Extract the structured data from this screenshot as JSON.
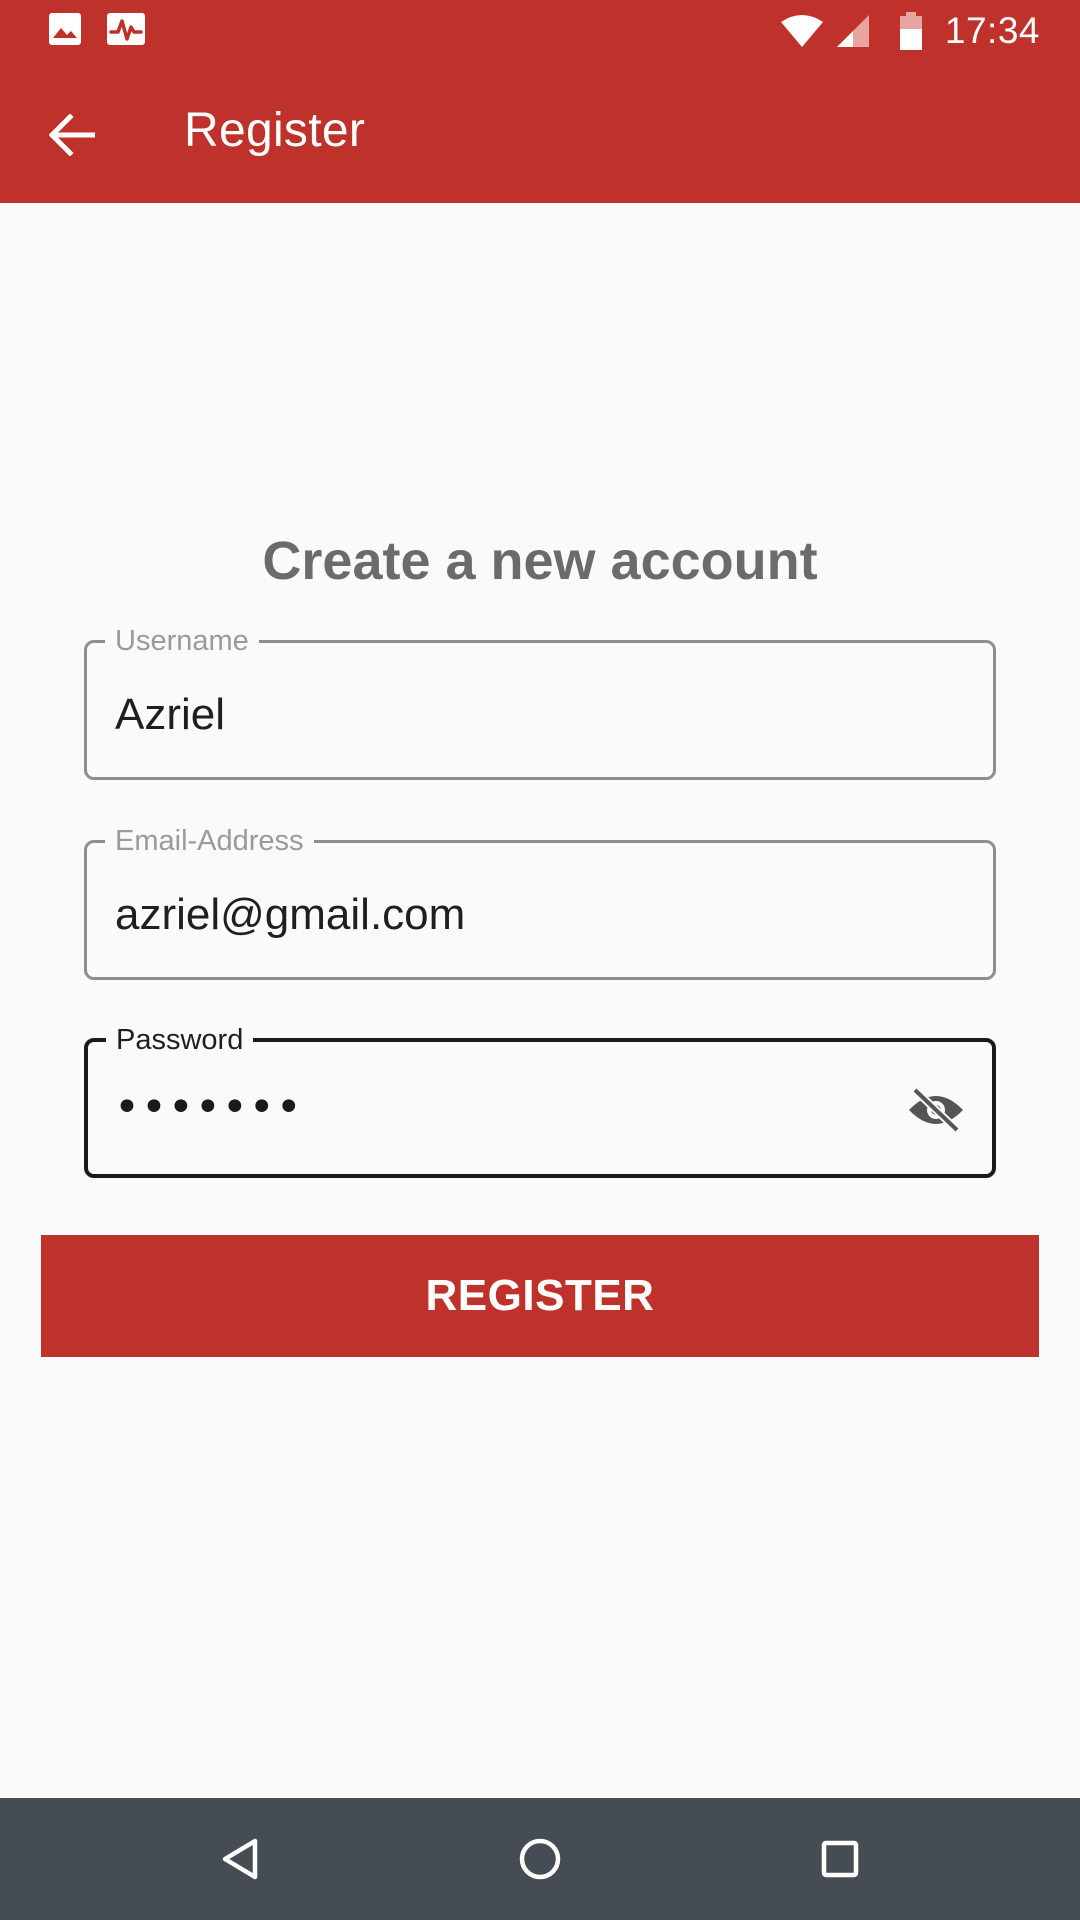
{
  "status_bar": {
    "time": "17:34",
    "left_icons": [
      "image-icon",
      "activity-icon"
    ],
    "right_icons": [
      "wifi-icon",
      "cell-signal-icon",
      "battery-icon"
    ]
  },
  "app_bar": {
    "title": "Register",
    "back_icon": "arrow-back-icon"
  },
  "form": {
    "heading": "Create a new account",
    "username": {
      "label": "Username",
      "value": "Azriel"
    },
    "email": {
      "label": "Email-Address",
      "value": "azriel@gmail.com"
    },
    "password": {
      "label": "Password",
      "value_masked": "•••••••",
      "toggle_icon": "visibility-off-icon",
      "focused": true
    },
    "submit_label": "REGISTER"
  },
  "nav_bar": {
    "buttons": [
      "back-triangle-icon",
      "home-circle-icon",
      "recents-square-icon"
    ]
  },
  "colors": {
    "primary": "#bf312b",
    "background": "#fafafa",
    "nav_bar": "#454c53",
    "heading_text": "#6b6b6b"
  }
}
